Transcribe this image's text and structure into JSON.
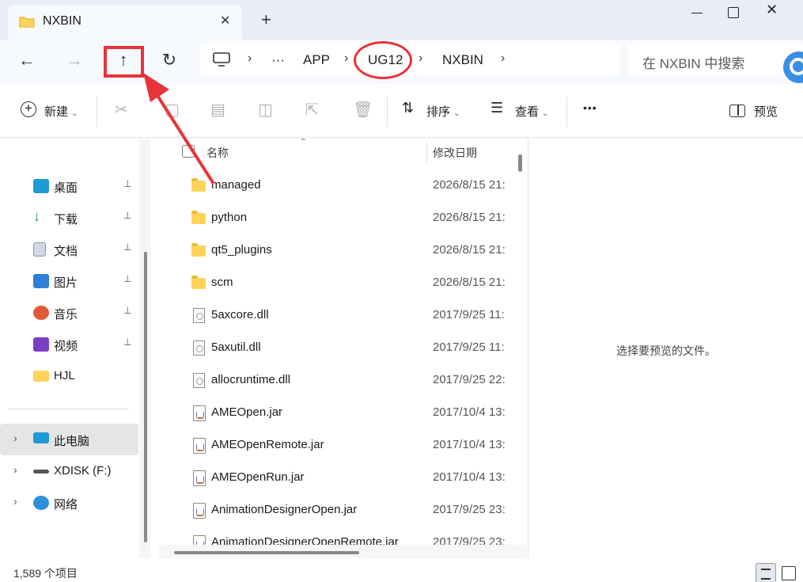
{
  "window": {
    "tab_title": "NXBIN",
    "tab_close": "✕",
    "new_tab": "+",
    "close_glyph": "✕"
  },
  "nav": {
    "back": "←",
    "forward": "→",
    "up": "↑",
    "refresh": "↻"
  },
  "address": {
    "more": "···",
    "sep": "›",
    "crumbs": [
      "APP",
      "UG12",
      "NXBIN"
    ]
  },
  "search": {
    "placeholder": "在 NXBIN 中搜索"
  },
  "toolbar": {
    "new_label": "新建",
    "sort_label": "排序",
    "view_label": "查看",
    "more": "•••",
    "preview_label": "预览",
    "caret": "⌄"
  },
  "sidebar": {
    "pin": "📌",
    "chevron": "›",
    "items": [
      {
        "label": "桌面",
        "icon": "desktop-icon",
        "pinned": true
      },
      {
        "label": "下载",
        "icon": "download-icon",
        "pinned": true
      },
      {
        "label": "文档",
        "icon": "document-icon",
        "pinned": true
      },
      {
        "label": "图片",
        "icon": "pictures-icon",
        "pinned": true
      },
      {
        "label": "音乐",
        "icon": "music-icon",
        "pinned": true
      },
      {
        "label": "视频",
        "icon": "video-icon",
        "pinned": true
      },
      {
        "label": "HJL",
        "icon": "folder-icon",
        "pinned": false
      }
    ],
    "devices": [
      {
        "label": "此电脑",
        "icon": "this-pc-icon",
        "selected": true
      },
      {
        "label": "XDISK (F:)",
        "icon": "drive-icon",
        "selected": false
      },
      {
        "label": "网络",
        "icon": "network-icon",
        "selected": false
      }
    ]
  },
  "filelist": {
    "col_name": "名称",
    "col_date": "修改日期",
    "sort_glyph": "⌃",
    "rows": [
      {
        "name": "managed",
        "date": "2026/8/15 21:",
        "type": "folder"
      },
      {
        "name": "python",
        "date": "2026/8/15 21:",
        "type": "folder"
      },
      {
        "name": "qt5_plugins",
        "date": "2026/8/15 21:",
        "type": "folder"
      },
      {
        "name": "scm",
        "date": "2026/8/15 21:",
        "type": "folder"
      },
      {
        "name": "5axcore.dll",
        "date": "2017/9/25 11:",
        "type": "dll"
      },
      {
        "name": "5axutil.dll",
        "date": "2017/9/25 11:",
        "type": "dll"
      },
      {
        "name": "allocruntime.dll",
        "date": "2017/9/25 22:",
        "type": "dll"
      },
      {
        "name": "AMEOpen.jar",
        "date": "2017/10/4 13:",
        "type": "jar"
      },
      {
        "name": "AMEOpenRemote.jar",
        "date": "2017/10/4 13:",
        "type": "jar"
      },
      {
        "name": "AMEOpenRun.jar",
        "date": "2017/10/4 13:",
        "type": "jar"
      },
      {
        "name": "AnimationDesignerOpen.jar",
        "date": "2017/9/25 23:",
        "type": "jar"
      },
      {
        "name": "AnimationDesignerOpenRemote.jar",
        "date": "2017/9/25 23:",
        "type": "jar"
      }
    ]
  },
  "preview": {
    "empty_text": "选择要预览的文件。"
  },
  "status": {
    "item_count": "1,589 个项目"
  },
  "colors": {
    "annotation_red": "#e8333a",
    "folder_yellow": "#ffd35b"
  }
}
